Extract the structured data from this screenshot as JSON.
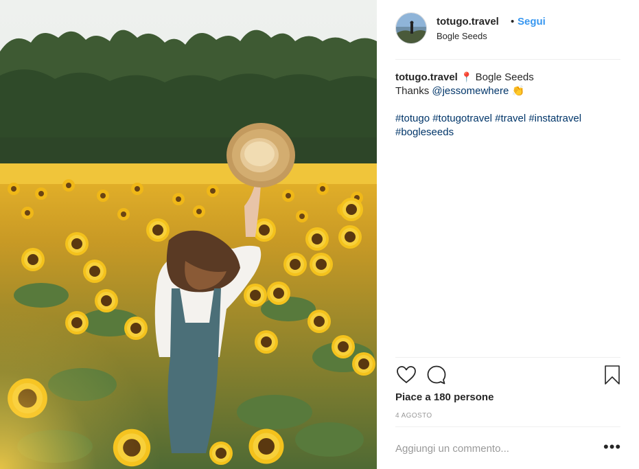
{
  "header": {
    "username": "totugo.travel",
    "separator": "•",
    "follow_label": "Segui",
    "location": "Bogle Seeds",
    "avatar_icon": "profile-avatar"
  },
  "caption": {
    "username": "totugo.travel",
    "pin_icon": "📍",
    "location": "Bogle Seeds",
    "thanks": "Thanks",
    "mention": "@jessomewhere",
    "emoji": "👏",
    "hashtags": [
      "#totugo",
      "#totugotravel",
      "#travel",
      "#instatravel",
      "#bogleseeds"
    ]
  },
  "actions": {
    "like_icon": "heart-icon",
    "comment_icon": "comment-icon",
    "save_icon": "bookmark-icon"
  },
  "likes": "Piace a 180 persone",
  "date": "4 AGOSTO",
  "comment": {
    "placeholder": "Aggiungi un commento..."
  },
  "more_label": "•••",
  "colors": {
    "link_blue": "#3897f0",
    "hashtag_blue": "#003569",
    "text": "#262626",
    "muted": "#999999",
    "divider": "#efefef"
  }
}
